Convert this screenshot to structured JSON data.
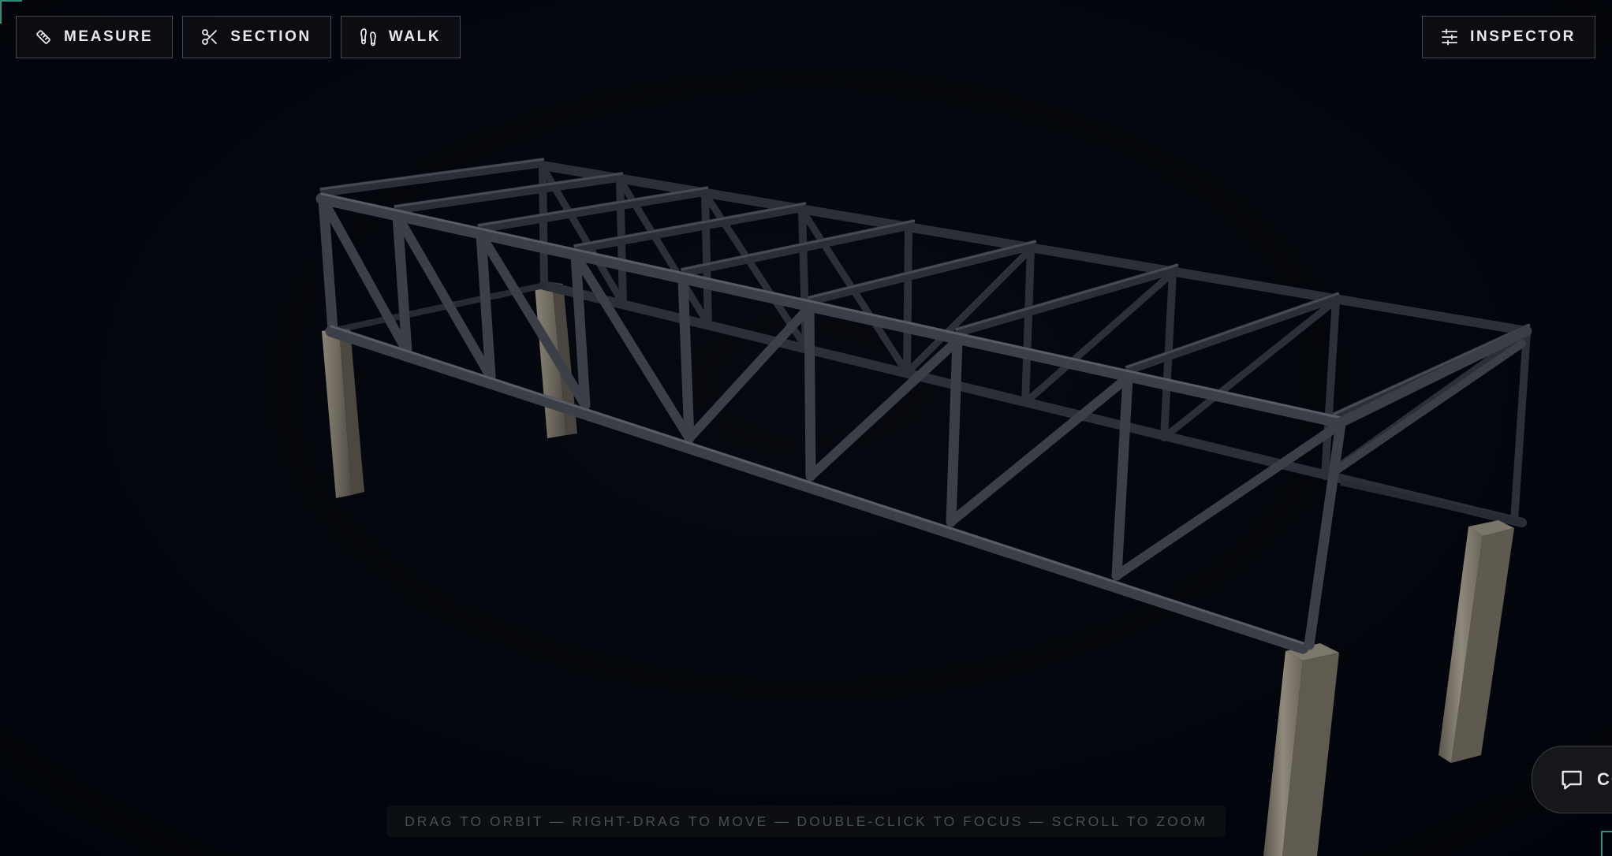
{
  "toolbar": {
    "measure": {
      "label": "MEASURE",
      "icon": "ruler-icon"
    },
    "section": {
      "label": "SECTION",
      "icon": "scissors-icon"
    },
    "walk": {
      "label": "WALK",
      "icon": "footsteps-icon"
    },
    "inspector": {
      "label": "INSPECTOR",
      "icon": "sliders-icon"
    }
  },
  "hint": {
    "text": "DRAG TO ORBIT — RIGHT-DRAG TO MOVE — DOUBLE-CLICK TO FOCUS — SCROLL TO ZOOM"
  },
  "comment": {
    "label": "CO",
    "icon": "chat-bubble-icon"
  },
  "colors": {
    "background": "#02050b",
    "steel": "#3c4049",
    "concrete": "#6a665c",
    "panel": "#0b0d12",
    "accent": "#2f8f7a"
  }
}
